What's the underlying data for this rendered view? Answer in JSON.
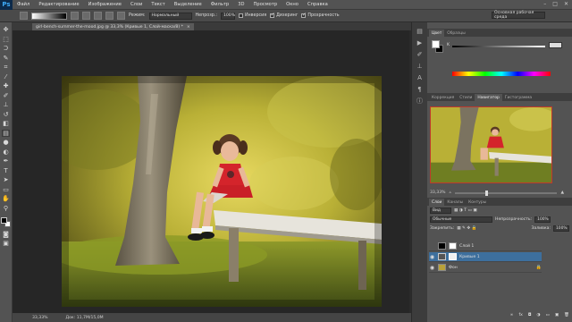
{
  "app": {
    "logo": "Ps"
  },
  "menu": [
    "Файл",
    "Редактирование",
    "Изображение",
    "Слои",
    "Текст",
    "Выделение",
    "Фильтр",
    "3D",
    "Просмотр",
    "Окно",
    "Справка"
  ],
  "window_controls": [
    "–",
    "□",
    "✕"
  ],
  "options": {
    "mode_label": "Режим:",
    "mode_value": "Нормальный",
    "opacity_label": "Непрозр.:",
    "opacity_value": "100%",
    "checks": [
      {
        "label": "Инверсия",
        "on": false
      },
      {
        "label": "Дизеринг",
        "on": true
      },
      {
        "label": "Прозрачность",
        "on": true
      }
    ],
    "workspace": "Основная рабочая среда"
  },
  "document": {
    "tab_title": "girl-bench-summer-the-mood.jpg @ 33,3% (Кривые 1, Слой-маска/8) *",
    "close": "×"
  },
  "status": {
    "zoom": "33,33%",
    "doc_size": "Док: 11,7M/15,0M"
  },
  "color_panel": {
    "tabs": [
      "Цвет",
      "Образцы"
    ],
    "slider_label": "K",
    "colors": {
      "foreground": "#ffffff",
      "background": "#000000"
    }
  },
  "nav_panel": {
    "tabs": [
      "Коррекция",
      "Стили",
      "Навигатор",
      "Гистограмма"
    ],
    "zoom": "33,33%"
  },
  "layers_panel": {
    "tabs": [
      "Слои",
      "Каналы",
      "Контуры"
    ],
    "filter_label": "Вид",
    "blend_mode": "Обычные",
    "opacity_label": "Непрозрачность:",
    "opacity_value": "100%",
    "lock_label": "Закрепить:",
    "fill_label": "Заливка:",
    "fill_value": "100%",
    "layers": [
      {
        "name": "Слой 1",
        "selected": false
      },
      {
        "name": "Кривые 1",
        "selected": true
      },
      {
        "name": "Фон",
        "selected": false
      }
    ]
  }
}
